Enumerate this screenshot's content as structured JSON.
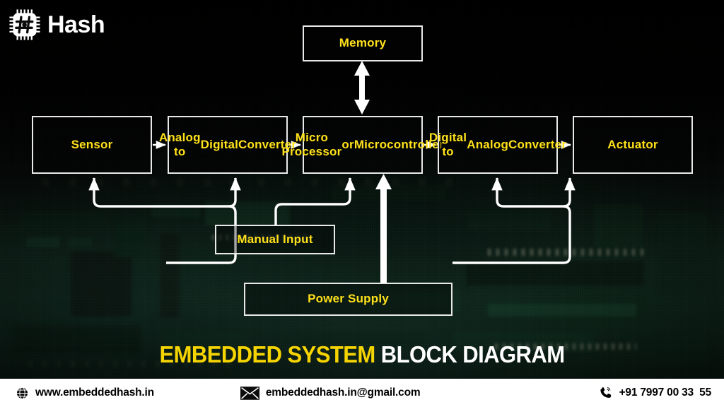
{
  "brand": {
    "logo_icon": "chip-hash-icon",
    "name": "Hash"
  },
  "diagram": {
    "blocks": [
      {
        "id": "memory",
        "label": "Memory"
      },
      {
        "id": "sensor",
        "label": "Sensor"
      },
      {
        "id": "adc",
        "label": "Analog to\nDigital\nConverter"
      },
      {
        "id": "mpu",
        "label": "Micro Processor\nor\nMicrocontroller"
      },
      {
        "id": "dac",
        "label": "Digital to\nAnalog\nConverter"
      },
      {
        "id": "actuator",
        "label": "Actuator"
      },
      {
        "id": "manual",
        "label": "Manual Input"
      },
      {
        "id": "power",
        "label": "Power Supply"
      }
    ],
    "connections": [
      {
        "from": "sensor",
        "to": "adc",
        "type": "signal",
        "direction": "one-way"
      },
      {
        "from": "adc",
        "to": "mpu",
        "type": "signal",
        "direction": "one-way"
      },
      {
        "from": "mpu",
        "to": "dac",
        "type": "signal",
        "direction": "one-way"
      },
      {
        "from": "dac",
        "to": "actuator",
        "type": "signal",
        "direction": "one-way"
      },
      {
        "from": "mpu",
        "to": "memory",
        "type": "bus",
        "direction": "two-way"
      },
      {
        "from": "manual",
        "to": "mpu",
        "type": "input",
        "direction": "one-way"
      },
      {
        "from": "power",
        "to": "mpu",
        "type": "power",
        "direction": "one-way"
      },
      {
        "from": "power",
        "to": "sensor",
        "type": "power",
        "direction": "one-way"
      },
      {
        "from": "power",
        "to": "adc",
        "type": "power",
        "direction": "one-way"
      },
      {
        "from": "power",
        "to": "dac",
        "type": "power",
        "direction": "one-way"
      },
      {
        "from": "power",
        "to": "actuator",
        "type": "power",
        "direction": "one-way"
      }
    ]
  },
  "title": {
    "highlight": "EMBEDDED SYSTEM",
    "rest": " BLOCK DIAGRAM"
  },
  "footer": {
    "website": {
      "icon": "globe-icon",
      "text": "www.embeddedhash.in"
    },
    "email": {
      "icon": "envelope-icon",
      "text": "embeddedhash.in@gmail.com"
    },
    "phone": {
      "icon": "phone-icon",
      "text": "+91 7997 00 33  55"
    }
  },
  "colors": {
    "accent_yellow": "#ffe11a",
    "title_yellow": "#f5d400",
    "line_white": "#ffffff",
    "box_border": "#e9e9e9",
    "footer_bg": "#ffffff",
    "background_dark": "#050505"
  }
}
